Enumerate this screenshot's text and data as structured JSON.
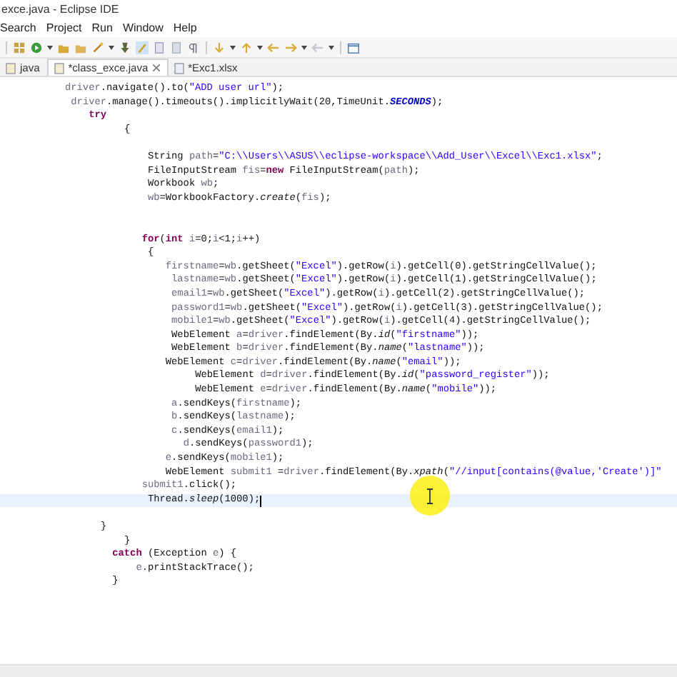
{
  "window": {
    "title": "exce.java - Eclipse IDE"
  },
  "menu": [
    "Search",
    "Project",
    "Run",
    "Window",
    "Help"
  ],
  "tabs": [
    {
      "label": "java",
      "selected": false
    },
    {
      "label": "*class_exce.java",
      "selected": true
    },
    {
      "label": "*Exc1.xlsx",
      "selected": false
    }
  ],
  "editor": {
    "lines": [
      {
        "kind": "code",
        "current": false,
        "tokens": [
          {
            "kind": "var",
            "text": "           driver"
          },
          {
            "kind": "plain",
            "text": ".navigate().to("
          },
          {
            "kind": "string",
            "text": "\"ADD user url\""
          },
          {
            "kind": "plain",
            "text": ");"
          }
        ]
      },
      {
        "kind": "code",
        "current": false,
        "tokens": [
          {
            "kind": "var",
            "text": "            driver"
          },
          {
            "kind": "plain",
            "text": ".manage().timeouts().implicitlyWait(20,TimeUnit."
          },
          {
            "kind": "constant",
            "text": "SECONDS"
          },
          {
            "kind": "plain",
            "text": ");"
          }
        ]
      },
      {
        "kind": "code",
        "current": false,
        "tokens": [
          {
            "kind": "keyword",
            "text": "               try"
          }
        ]
      },
      {
        "kind": "code",
        "current": false,
        "tokens": [
          {
            "kind": "plain",
            "text": "                     {"
          }
        ]
      },
      {
        "kind": "blank"
      },
      {
        "kind": "code",
        "current": false,
        "tokens": [
          {
            "kind": "plain",
            "text": "                         String "
          },
          {
            "kind": "var",
            "text": "path"
          },
          {
            "kind": "plain",
            "text": "="
          },
          {
            "kind": "string",
            "text": "\"C:\\\\Users\\\\ASUS\\\\eclipse-workspace\\\\Add_User\\\\Excel\\\\Exc1.xlsx\""
          },
          {
            "kind": "plain",
            "text": ";"
          }
        ]
      },
      {
        "kind": "code",
        "current": false,
        "tokens": [
          {
            "kind": "plain",
            "text": "                         FileInputStream "
          },
          {
            "kind": "var",
            "text": "fis"
          },
          {
            "kind": "plain",
            "text": "="
          },
          {
            "kind": "keyword",
            "text": "new"
          },
          {
            "kind": "plain",
            "text": " FileInputStream("
          },
          {
            "kind": "var",
            "text": "path"
          },
          {
            "kind": "plain",
            "text": ");"
          }
        ]
      },
      {
        "kind": "code",
        "current": false,
        "tokens": [
          {
            "kind": "plain",
            "text": "                         Workbook "
          },
          {
            "kind": "var",
            "text": "wb"
          },
          {
            "kind": "plain",
            "text": ";"
          }
        ]
      },
      {
        "kind": "code",
        "current": false,
        "tokens": [
          {
            "kind": "var",
            "text": "                         wb"
          },
          {
            "kind": "plain",
            "text": "=WorkbookFactory."
          },
          {
            "kind": "static",
            "text": "create"
          },
          {
            "kind": "plain",
            "text": "("
          },
          {
            "kind": "var",
            "text": "fis"
          },
          {
            "kind": "plain",
            "text": ");"
          }
        ]
      },
      {
        "kind": "blank"
      },
      {
        "kind": "blank"
      },
      {
        "kind": "code",
        "current": false,
        "tokens": [
          {
            "kind": "keyword",
            "text": "                        for"
          },
          {
            "kind": "plain",
            "text": "("
          },
          {
            "kind": "keyword",
            "text": "int"
          },
          {
            "kind": "var",
            "text": " i"
          },
          {
            "kind": "plain",
            "text": "=0;"
          },
          {
            "kind": "var",
            "text": "i"
          },
          {
            "kind": "plain",
            "text": "<1;"
          },
          {
            "kind": "var",
            "text": "i"
          },
          {
            "kind": "plain",
            "text": "++)"
          }
        ]
      },
      {
        "kind": "code",
        "current": false,
        "tokens": [
          {
            "kind": "plain",
            "text": "                         {"
          }
        ]
      },
      {
        "kind": "code",
        "current": false,
        "tokens": [
          {
            "kind": "var",
            "text": "                            firstname"
          },
          {
            "kind": "plain",
            "text": "="
          },
          {
            "kind": "var",
            "text": "wb"
          },
          {
            "kind": "plain",
            "text": ".getSheet("
          },
          {
            "kind": "string",
            "text": "\"Excel\""
          },
          {
            "kind": "plain",
            "text": ").getRow("
          },
          {
            "kind": "var",
            "text": "i"
          },
          {
            "kind": "plain",
            "text": ").getCell(0).getStringCellValue();"
          }
        ]
      },
      {
        "kind": "code",
        "current": false,
        "tokens": [
          {
            "kind": "var",
            "text": "                             lastname"
          },
          {
            "kind": "plain",
            "text": "="
          },
          {
            "kind": "var",
            "text": "wb"
          },
          {
            "kind": "plain",
            "text": ".getSheet("
          },
          {
            "kind": "string",
            "text": "\"Excel\""
          },
          {
            "kind": "plain",
            "text": ").getRow("
          },
          {
            "kind": "var",
            "text": "i"
          },
          {
            "kind": "plain",
            "text": ").getCell(1).getStringCellValue();"
          }
        ]
      },
      {
        "kind": "code",
        "current": false,
        "tokens": [
          {
            "kind": "var",
            "text": "                             email1"
          },
          {
            "kind": "plain",
            "text": "="
          },
          {
            "kind": "var",
            "text": "wb"
          },
          {
            "kind": "plain",
            "text": ".getSheet("
          },
          {
            "kind": "string",
            "text": "\"Excel\""
          },
          {
            "kind": "plain",
            "text": ").getRow("
          },
          {
            "kind": "var",
            "text": "i"
          },
          {
            "kind": "plain",
            "text": ").getCell(2).getStringCellValue();"
          }
        ]
      },
      {
        "kind": "code",
        "current": false,
        "tokens": [
          {
            "kind": "var",
            "text": "                             password1"
          },
          {
            "kind": "plain",
            "text": "="
          },
          {
            "kind": "var",
            "text": "wb"
          },
          {
            "kind": "plain",
            "text": ".getSheet("
          },
          {
            "kind": "string",
            "text": "\"Excel\""
          },
          {
            "kind": "plain",
            "text": ").getRow("
          },
          {
            "kind": "var",
            "text": "i"
          },
          {
            "kind": "plain",
            "text": ").getCell(3).getStringCellValue();"
          }
        ]
      },
      {
        "kind": "code",
        "current": false,
        "tokens": [
          {
            "kind": "var",
            "text": "                             mobile1"
          },
          {
            "kind": "plain",
            "text": "="
          },
          {
            "kind": "var",
            "text": "wb"
          },
          {
            "kind": "plain",
            "text": ".getSheet("
          },
          {
            "kind": "string",
            "text": "\"Excel\""
          },
          {
            "kind": "plain",
            "text": ").getRow("
          },
          {
            "kind": "var",
            "text": "i"
          },
          {
            "kind": "plain",
            "text": ").getCell(4).getStringCellValue();"
          }
        ]
      },
      {
        "kind": "code",
        "current": false,
        "tokens": [
          {
            "kind": "plain",
            "text": "                             WebElement "
          },
          {
            "kind": "var",
            "text": "a"
          },
          {
            "kind": "plain",
            "text": "="
          },
          {
            "kind": "var",
            "text": "driver"
          },
          {
            "kind": "plain",
            "text": ".findElement(By."
          },
          {
            "kind": "static",
            "text": "id"
          },
          {
            "kind": "plain",
            "text": "("
          },
          {
            "kind": "string",
            "text": "\"firstname\""
          },
          {
            "kind": "plain",
            "text": "));"
          }
        ]
      },
      {
        "kind": "code",
        "current": false,
        "tokens": [
          {
            "kind": "plain",
            "text": "                             WebElement "
          },
          {
            "kind": "var",
            "text": "b"
          },
          {
            "kind": "plain",
            "text": "="
          },
          {
            "kind": "var",
            "text": "driver"
          },
          {
            "kind": "plain",
            "text": ".findElement(By."
          },
          {
            "kind": "static",
            "text": "name"
          },
          {
            "kind": "plain",
            "text": "("
          },
          {
            "kind": "string",
            "text": "\"lastname\""
          },
          {
            "kind": "plain",
            "text": "));"
          }
        ]
      },
      {
        "kind": "code",
        "current": false,
        "tokens": [
          {
            "kind": "plain",
            "text": "                            WebElement "
          },
          {
            "kind": "var",
            "text": "c"
          },
          {
            "kind": "plain",
            "text": "="
          },
          {
            "kind": "var",
            "text": "driver"
          },
          {
            "kind": "plain",
            "text": ".findElement(By."
          },
          {
            "kind": "static",
            "text": "name"
          },
          {
            "kind": "plain",
            "text": "("
          },
          {
            "kind": "string",
            "text": "\"email\""
          },
          {
            "kind": "plain",
            "text": "));"
          }
        ]
      },
      {
        "kind": "code",
        "current": false,
        "tokens": [
          {
            "kind": "plain",
            "text": "                                 WebElement "
          },
          {
            "kind": "var",
            "text": "d"
          },
          {
            "kind": "plain",
            "text": "="
          },
          {
            "kind": "var",
            "text": "driver"
          },
          {
            "kind": "plain",
            "text": ".findElement(By."
          },
          {
            "kind": "static",
            "text": "id"
          },
          {
            "kind": "plain",
            "text": "("
          },
          {
            "kind": "string",
            "text": "\"password_register\""
          },
          {
            "kind": "plain",
            "text": "));"
          }
        ]
      },
      {
        "kind": "code",
        "current": false,
        "tokens": [
          {
            "kind": "plain",
            "text": "                                 WebElement "
          },
          {
            "kind": "var",
            "text": "e"
          },
          {
            "kind": "plain",
            "text": "="
          },
          {
            "kind": "var",
            "text": "driver"
          },
          {
            "kind": "plain",
            "text": ".findElement(By."
          },
          {
            "kind": "static",
            "text": "name"
          },
          {
            "kind": "plain",
            "text": "("
          },
          {
            "kind": "string",
            "text": "\"mobile\""
          },
          {
            "kind": "plain",
            "text": "));"
          }
        ]
      },
      {
        "kind": "code",
        "current": false,
        "tokens": [
          {
            "kind": "var",
            "text": "                             a"
          },
          {
            "kind": "plain",
            "text": ".sendKeys("
          },
          {
            "kind": "var",
            "text": "firstname"
          },
          {
            "kind": "plain",
            "text": ");"
          }
        ]
      },
      {
        "kind": "code",
        "current": false,
        "tokens": [
          {
            "kind": "var",
            "text": "                             b"
          },
          {
            "kind": "plain",
            "text": ".sendKeys("
          },
          {
            "kind": "var",
            "text": "lastname"
          },
          {
            "kind": "plain",
            "text": ");"
          }
        ]
      },
      {
        "kind": "code",
        "current": false,
        "tokens": [
          {
            "kind": "var",
            "text": "                             c"
          },
          {
            "kind": "plain",
            "text": ".sendKeys("
          },
          {
            "kind": "var",
            "text": "email1"
          },
          {
            "kind": "plain",
            "text": ");"
          }
        ]
      },
      {
        "kind": "code",
        "current": false,
        "tokens": [
          {
            "kind": "var",
            "text": "                               d"
          },
          {
            "kind": "plain",
            "text": ".sendKeys("
          },
          {
            "kind": "var",
            "text": "password1"
          },
          {
            "kind": "plain",
            "text": ");"
          }
        ]
      },
      {
        "kind": "code",
        "current": false,
        "tokens": [
          {
            "kind": "var",
            "text": "                            e"
          },
          {
            "kind": "plain",
            "text": ".sendKeys("
          },
          {
            "kind": "var",
            "text": "mobile1"
          },
          {
            "kind": "plain",
            "text": ");"
          }
        ]
      },
      {
        "kind": "code",
        "current": false,
        "tokens": [
          {
            "kind": "plain",
            "text": "                            WebElement "
          },
          {
            "kind": "var",
            "text": "submit1"
          },
          {
            "kind": "plain",
            "text": " ="
          },
          {
            "kind": "var",
            "text": "driver"
          },
          {
            "kind": "plain",
            "text": ".findElement(By."
          },
          {
            "kind": "static",
            "text": "xpath"
          },
          {
            "kind": "plain",
            "text": "("
          },
          {
            "kind": "string",
            "text": "\"//input[contains(@value,'Create')]\""
          }
        ]
      },
      {
        "kind": "code",
        "current": false,
        "tokens": [
          {
            "kind": "var",
            "text": "                        submit1"
          },
          {
            "kind": "plain",
            "text": ".click();"
          }
        ]
      },
      {
        "kind": "code",
        "current": true,
        "tokens": [
          {
            "kind": "plain",
            "text": "                         Thread."
          },
          {
            "kind": "static",
            "text": "sleep"
          },
          {
            "kind": "plain",
            "text": "(1000);"
          }
        ]
      },
      {
        "kind": "blank"
      },
      {
        "kind": "code",
        "current": false,
        "tokens": [
          {
            "kind": "plain",
            "text": "                 }"
          }
        ]
      },
      {
        "kind": "code",
        "current": false,
        "tokens": [
          {
            "kind": "plain",
            "text": "                     }"
          }
        ]
      },
      {
        "kind": "code",
        "current": false,
        "tokens": [
          {
            "kind": "keyword",
            "text": "                   catch"
          },
          {
            "kind": "plain",
            "text": " (Exception "
          },
          {
            "kind": "var",
            "text": "e"
          },
          {
            "kind": "plain",
            "text": ") {"
          }
        ]
      },
      {
        "kind": "code",
        "current": false,
        "tokens": [
          {
            "kind": "var",
            "text": "                       e"
          },
          {
            "kind": "plain",
            "text": ".printStackTrace();"
          }
        ]
      },
      {
        "kind": "code",
        "current": false,
        "tokens": [
          {
            "kind": "plain",
            "text": "                   }"
          }
        ]
      }
    ]
  }
}
